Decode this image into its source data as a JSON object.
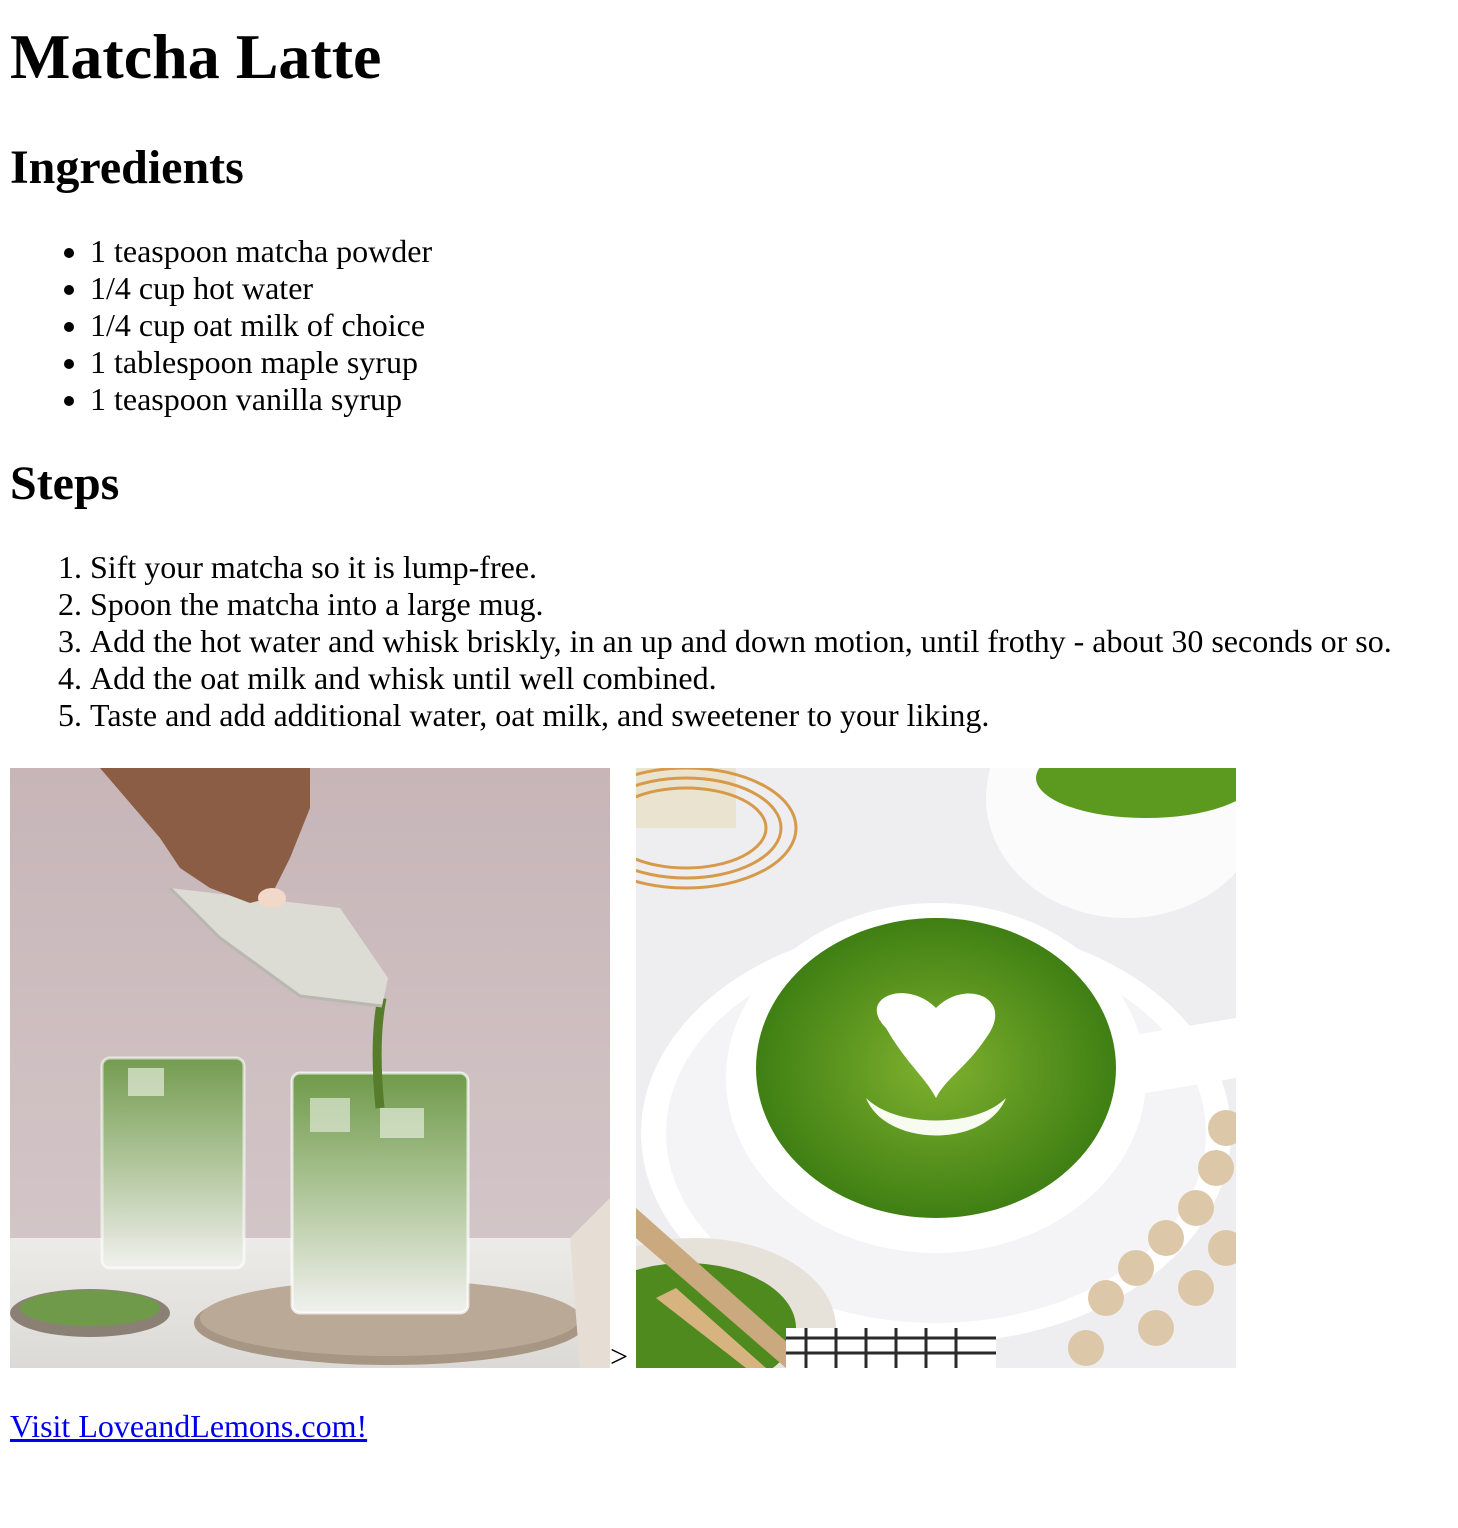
{
  "title": "Matcha Latte",
  "ingredients": {
    "heading": "Ingredients",
    "items": [
      "1 teaspoon matcha powder",
      "1/4 cup hot water",
      "1/4 cup oat milk of choice",
      "1 tablespoon maple syrup",
      "1 teaspoon vanilla syrup"
    ]
  },
  "steps": {
    "heading": "Steps",
    "items": [
      "Sift your matcha so it is lump-free.",
      "Spoon the matcha into a large mug.",
      "Add the hot water and whisk briskly, in an up and down motion, until frothy - about 30 seconds or so.",
      "Add the oat milk and whisk until well combined.",
      "Taste and add additional water, oat milk, and sweetener to your liking."
    ]
  },
  "stray_text": ">",
  "link": {
    "label": "Visit LoveandLemons.com!"
  },
  "colors": {
    "link": "#0000ee",
    "matcha_green": "#4f8f1c",
    "wall_pink": "#cbbcbd"
  }
}
